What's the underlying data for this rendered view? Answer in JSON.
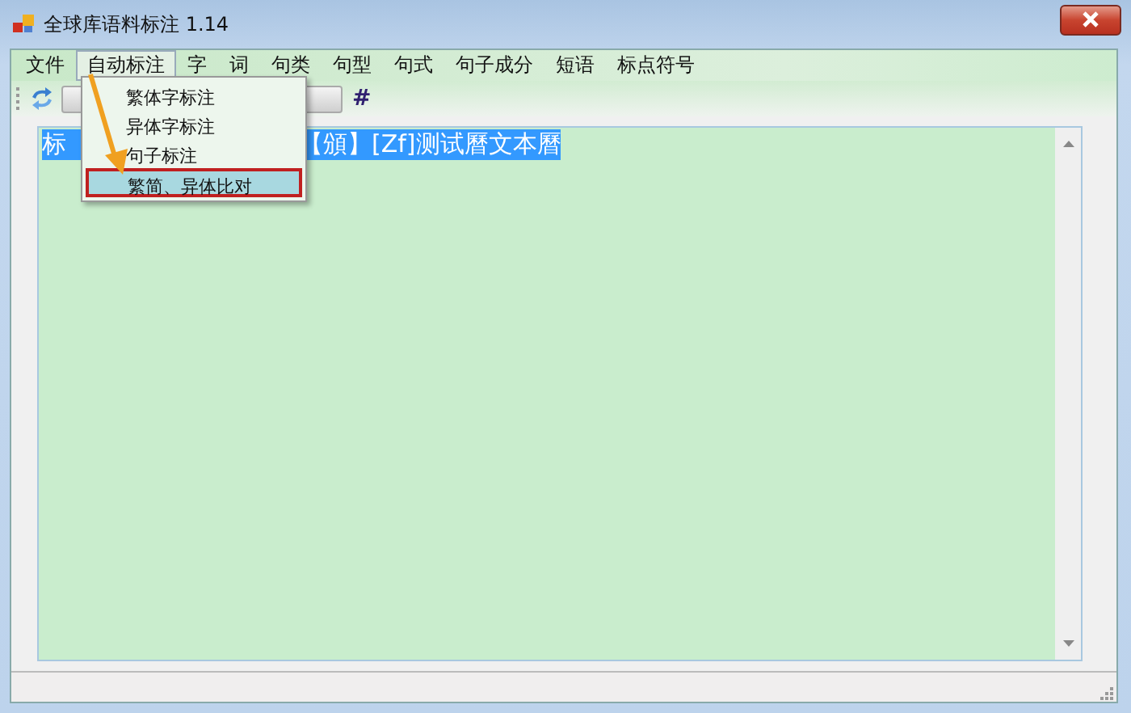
{
  "window": {
    "title": "全球库语料标注 1.14"
  },
  "menu_bar": [
    {
      "label": "文件",
      "selected": false
    },
    {
      "label": "自动标注",
      "selected": true
    },
    {
      "label": "字",
      "selected": false
    },
    {
      "label": "词",
      "selected": false
    },
    {
      "label": "句类",
      "selected": false
    },
    {
      "label": "句型",
      "selected": false
    },
    {
      "label": "句式",
      "selected": false
    },
    {
      "label": "句子成分",
      "selected": false
    },
    {
      "label": "短语",
      "selected": false
    },
    {
      "label": "标点符号",
      "selected": false
    }
  ],
  "dropdown_menu": [
    {
      "label": "繁体字标注",
      "selected": false
    },
    {
      "label": "异体字标注",
      "selected": false
    },
    {
      "label": "句子标注",
      "selected": false
    },
    {
      "label": "繁简、异体比对",
      "selected": true
    }
  ],
  "toolbar": {
    "hash_button": "#"
  },
  "editor": {
    "visible_text_parts": [
      "标",
      "【頒】[Zf]测试曆文本曆"
    ]
  }
}
